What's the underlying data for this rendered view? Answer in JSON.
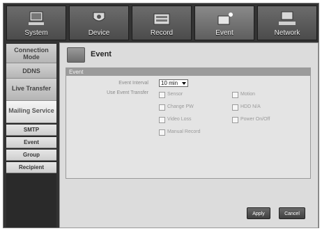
{
  "tabs": [
    {
      "label": "System",
      "icon": "monitor-icon"
    },
    {
      "label": "Device",
      "icon": "camera-icon"
    },
    {
      "label": "Record",
      "icon": "record-icon"
    },
    {
      "label": "Event",
      "icon": "event-icon"
    },
    {
      "label": "Network",
      "icon": "network-icon"
    }
  ],
  "sidebar": {
    "items": [
      {
        "label": "Connection Mode"
      },
      {
        "label": "DDNS"
      },
      {
        "label": "Live Transfer"
      },
      {
        "label": "Mailing Service"
      },
      {
        "label": "SMTP"
      },
      {
        "label": "Event"
      },
      {
        "label": "Group"
      },
      {
        "label": "Recipient"
      }
    ]
  },
  "page": {
    "title": "Event",
    "icon": "event-page-icon"
  },
  "event_group": {
    "header": "Event",
    "interval_label": "Event Interval",
    "interval_value": "10 min",
    "transfer_label": "Use Event Transfer",
    "options": [
      {
        "label": "Sensor"
      },
      {
        "label": "Motion"
      },
      {
        "label": "Change PW"
      },
      {
        "label": "HDD N/A"
      },
      {
        "label": "Video Loss"
      },
      {
        "label": "Power On/Off"
      },
      {
        "label": "Manual Record"
      }
    ]
  },
  "buttons": {
    "apply": "Apply",
    "cancel": "Cancel"
  }
}
